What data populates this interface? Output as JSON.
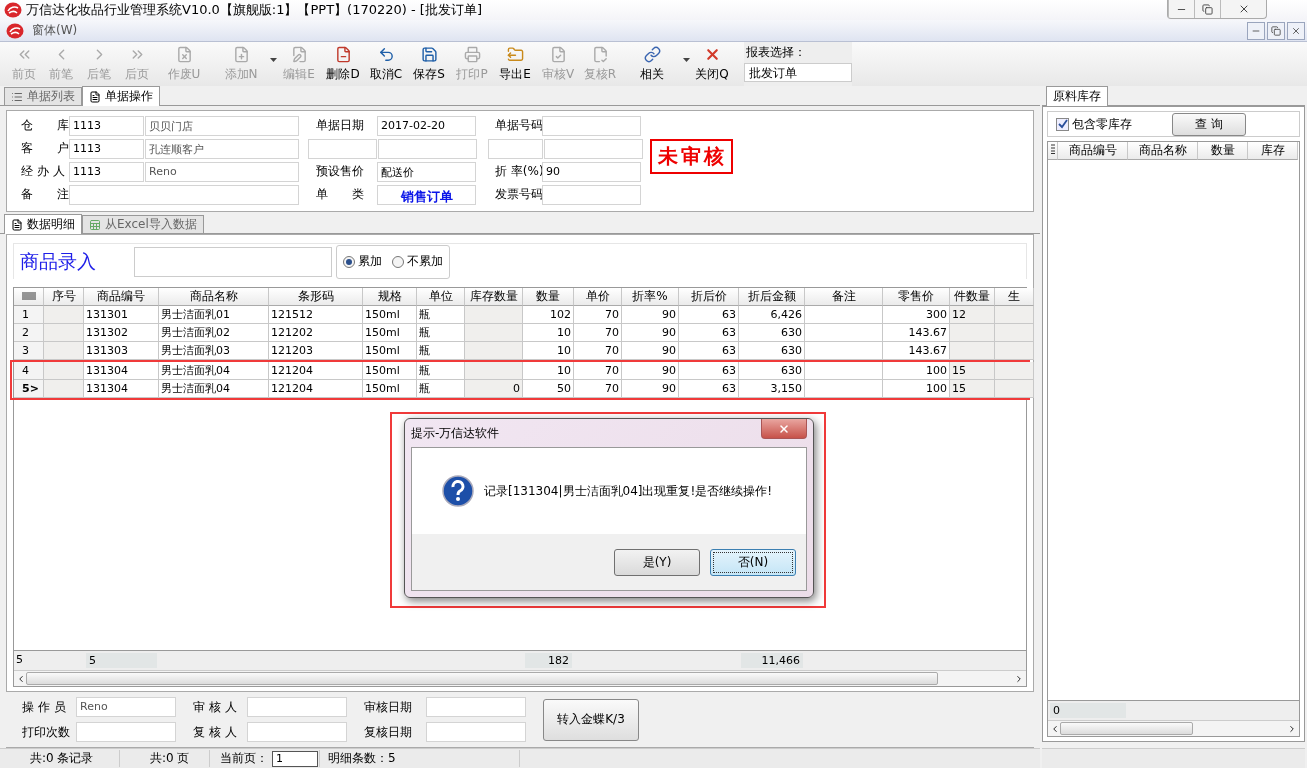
{
  "window": {
    "title": "万信达化妆品行业管理系统V10.0【旗舰版:1】【PPT】(170220) - [批发订单]"
  },
  "menu": [
    {
      "label": "窗体(W)"
    }
  ],
  "toolbar": [
    {
      "label": "前页",
      "disabled": true,
      "has_menu": false
    },
    {
      "label": "前笔",
      "disabled": true,
      "has_menu": false
    },
    {
      "label": "后笔",
      "disabled": true,
      "has_menu": false
    },
    {
      "label": "后页",
      "disabled": true,
      "has_menu": false
    },
    {
      "label": "作废U",
      "disabled": true,
      "has_menu": false
    },
    {
      "label": "添加N",
      "disabled": true,
      "has_menu": true
    },
    {
      "label": "编辑E",
      "disabled": true,
      "has_menu": false
    },
    {
      "label": "删除D",
      "disabled": false,
      "has_menu": false
    },
    {
      "label": "取消C",
      "disabled": false,
      "has_menu": false
    },
    {
      "label": "保存S",
      "disabled": false,
      "has_menu": false
    },
    {
      "label": "打印P",
      "disabled": true,
      "has_menu": false
    },
    {
      "label": "导出E",
      "disabled": false,
      "has_menu": false
    },
    {
      "label": "审核V",
      "disabled": true,
      "has_menu": false
    },
    {
      "label": "复核R",
      "disabled": true,
      "has_menu": false
    },
    {
      "label": "相关",
      "disabled": false,
      "has_menu": true
    },
    {
      "label": "关闭Q",
      "disabled": false,
      "has_menu": false
    }
  ],
  "report_select": {
    "label": "报表选择：",
    "value": "批发订单"
  },
  "tabs": [
    {
      "label": "单据列表",
      "selected": false
    },
    {
      "label": "单据操作",
      "selected": true
    }
  ],
  "header_form": {
    "rows": [
      {
        "left": {
          "label": "仓　　库",
          "code": "1113",
          "name": "贝贝门店"
        },
        "middle": {
          "label": "单据日期",
          "value": "2017-02-20"
        },
        "right": {
          "label": "单据号码"
        }
      },
      {
        "left": {
          "label": "客　　户",
          "code": "1113",
          "name": "孔连顺客户"
        }
      },
      {
        "left": {
          "label": "经 办 人",
          "code": "1113",
          "name": "Reno"
        },
        "middle": {
          "label": "预设售价",
          "value": "配送价"
        },
        "right": {
          "label": "折 率(%)",
          "value": "90"
        }
      },
      {
        "left": {
          "label": "备　　注"
        },
        "middle": {
          "label": "单　　类",
          "value": "销售订单",
          "highlight": true
        },
        "right": {
          "label": "发票号码"
        }
      }
    ],
    "stamp": "未审核"
  },
  "detail_tabs": [
    {
      "label": "数据明细",
      "selected": true
    },
    {
      "label": "从Excel导入数据",
      "selected": false
    }
  ],
  "entry": {
    "label": "商品录入",
    "options": [
      {
        "label": "累加",
        "selected": true
      },
      {
        "label": "不累加",
        "selected": false
      }
    ]
  },
  "grid": {
    "columns": [
      "序号",
      "商品编号",
      "商品名称",
      "条形码",
      "规格",
      "单位",
      "库存数量",
      "数量",
      "单价",
      "折率%",
      "折后价",
      "折后金额",
      "备注",
      "零售价",
      "件数量",
      "生"
    ],
    "rows": [
      {
        "marker": "1",
        "selected": false,
        "highlighted": false,
        "cells": [
          null,
          "131301",
          "男士洁面乳01",
          "121512",
          "150ml",
          "瓶",
          null,
          "102",
          "70",
          "90",
          "63",
          "6,426",
          null,
          "300",
          "12",
          null
        ]
      },
      {
        "marker": "2",
        "selected": false,
        "highlighted": false,
        "cells": [
          null,
          "131302",
          "男士洁面乳02",
          "121202",
          "150ml",
          "瓶",
          null,
          "10",
          "70",
          "90",
          "63",
          "630",
          null,
          "143.67",
          null,
          null
        ]
      },
      {
        "marker": "3",
        "selected": false,
        "highlighted": false,
        "cells": [
          null,
          "131303",
          "男士洁面乳03",
          "121203",
          "150ml",
          "瓶",
          null,
          "10",
          "70",
          "90",
          "63",
          "630",
          null,
          "143.67",
          null,
          null
        ]
      },
      {
        "marker": "4",
        "selected": false,
        "highlighted": true,
        "cells": [
          null,
          "131304",
          "男士洁面乳04",
          "121204",
          "150ml",
          "瓶",
          null,
          "10",
          "70",
          "90",
          "63",
          "630",
          null,
          "100",
          "15",
          null
        ]
      },
      {
        "marker": "5>",
        "selected": true,
        "highlighted": true,
        "cells": [
          null,
          "131304",
          "男士洁面乳04",
          "121204",
          "150ml",
          "瓶",
          "0",
          "50",
          "70",
          "90",
          "63",
          "3,150",
          null,
          "100",
          "15",
          null
        ]
      }
    ],
    "totals": {
      "marker": "5",
      "cells": [
        null,
        "5",
        null,
        null,
        null,
        null,
        null,
        "182",
        null,
        null,
        null,
        "11,466",
        null,
        null,
        null,
        null
      ]
    }
  },
  "dialog": {
    "title": "提示-万信达软件",
    "message": "记录[131304|男士洁面乳04]出现重复!是否继续操作!",
    "buttons": [
      {
        "label": "是(Y)",
        "selected": false
      },
      {
        "label": "否(N)",
        "selected": true
      }
    ]
  },
  "footer": {
    "fields": [
      {
        "label": "操 作 员",
        "value": "Reno"
      },
      {
        "label": "打印次数"
      },
      {
        "label": "审 核 人"
      },
      {
        "label": "复 核 人"
      },
      {
        "label": "审核日期"
      },
      {
        "label": "复核日期"
      }
    ],
    "button": "转入金蝶K/3"
  },
  "status_bar": {
    "records": "共:0 条记录",
    "pages": "共:0 页",
    "page_label": "当前页：",
    "page_value": "1",
    "detail_count": "明细条数：5"
  },
  "side_panel": {
    "tab": "原料库存",
    "checkbox": {
      "label": "包含零库存",
      "checked": true
    },
    "button": "查 询",
    "columns": [
      "商品编号",
      "商品名称",
      "数量",
      "库存"
    ],
    "total": "0"
  }
}
